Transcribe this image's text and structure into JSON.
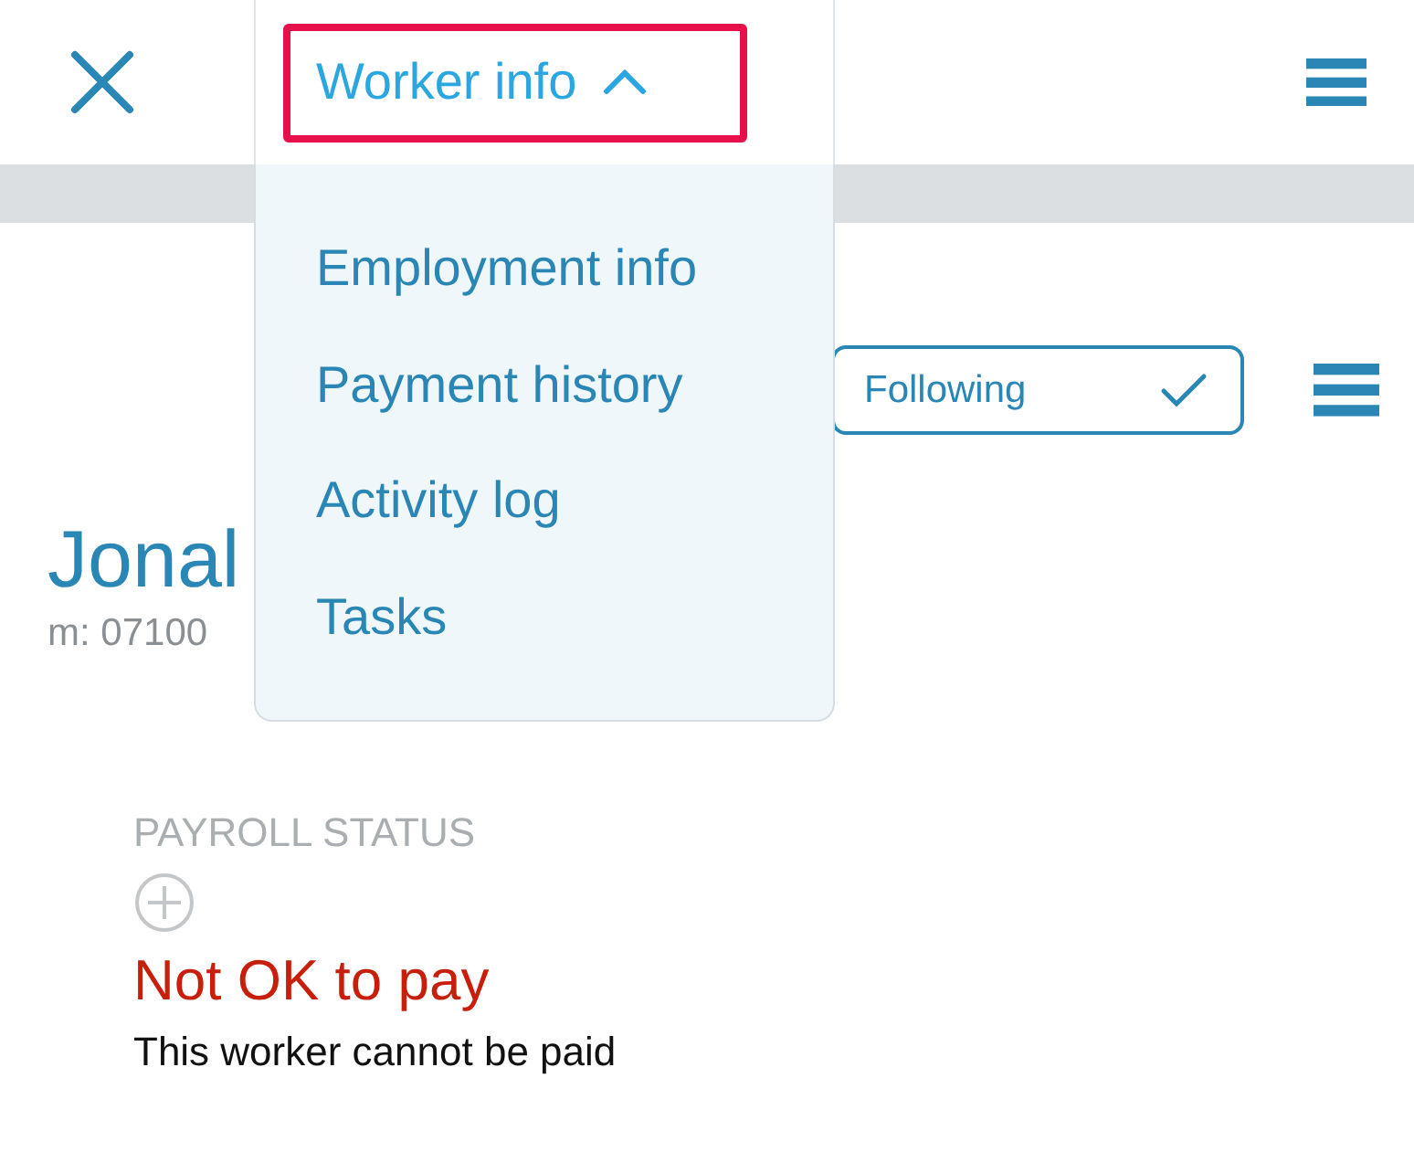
{
  "menu": {
    "toggle": {
      "label": "Worker info",
      "expanded": true
    },
    "items": [
      "Employment info",
      "Payment history",
      "Activity log",
      "Tasks"
    ]
  },
  "follow_button": {
    "label": "Following",
    "checked": true
  },
  "worker": {
    "name": "Jonal",
    "phone": "m: 07100"
  },
  "payroll": {
    "label": "PAYROLL STATUS",
    "status": "Not OK to pay",
    "ok": false,
    "description": "This worker cannot be paid"
  }
}
